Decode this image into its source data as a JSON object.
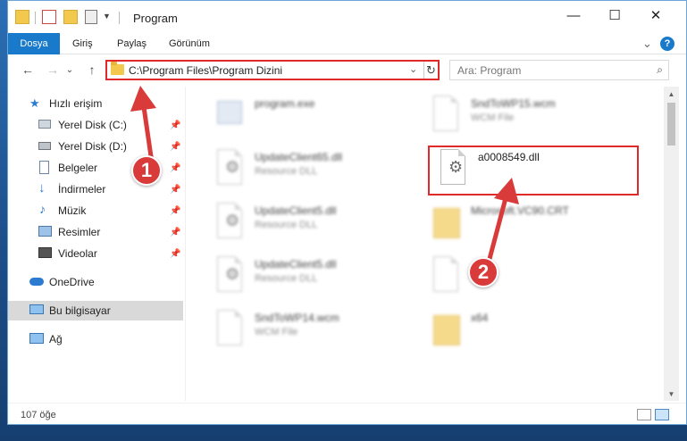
{
  "window": {
    "title": "Program",
    "controls": {
      "minimize": "—",
      "maximize": "☐",
      "close": "✕"
    }
  },
  "ribbon": {
    "tabs": [
      "Dosya",
      "Giriş",
      "Paylaş",
      "Görünüm"
    ],
    "expand_icon": "⌄",
    "help_icon": "?"
  },
  "address": {
    "back": "←",
    "forward": "→",
    "recent": "⌄",
    "up": "↑",
    "path": "C:\\Program Files\\Program Dizini",
    "dropdown": "⌄",
    "refresh": "↻"
  },
  "search": {
    "placeholder": "Ara: Program",
    "icon": "⌕"
  },
  "sidebar": {
    "items": [
      {
        "label": "Hızlı erişim",
        "icon": "star-icon"
      },
      {
        "label": "Yerel Disk (C:)",
        "icon": "drive-icon",
        "pinned": true
      },
      {
        "label": "Yerel Disk (D:)",
        "icon": "drive-icon",
        "pinned": true
      },
      {
        "label": "Belgeler",
        "icon": "documents-icon",
        "pinned": true
      },
      {
        "label": "İndirmeler",
        "icon": "download-icon",
        "pinned": true
      },
      {
        "label": "Müzik",
        "icon": "music-icon",
        "pinned": true
      },
      {
        "label": "Resimler",
        "icon": "pictures-icon",
        "pinned": true
      },
      {
        "label": "Videolar",
        "icon": "videos-icon",
        "pinned": true
      },
      {
        "label": "OneDrive",
        "icon": "cloud-icon"
      },
      {
        "label": "Bu bilgisayar",
        "icon": "computer-icon",
        "selected": true
      },
      {
        "label": "Ağ",
        "icon": "network-icon"
      }
    ],
    "pin_glyph": "📌"
  },
  "files": [
    {
      "name": "program.exe",
      "type": ""
    },
    {
      "name": "SndToWP15.wcm",
      "type": "WCM File"
    },
    {
      "name": "UpdateClient65.dll",
      "type": "Resource DLL"
    },
    {
      "name": "a0008549.dll",
      "type": ""
    },
    {
      "name": "UpdateClient5.dll",
      "type": "Resource DLL"
    },
    {
      "name": "Microsoft.VC90.CRT",
      "type": ""
    },
    {
      "name": "UpdateClient5.dll",
      "type": "Resource DLL"
    },
    {
      "name": "",
      "type": ""
    },
    {
      "name": "SndToWP14.wcm",
      "type": "WCM File"
    },
    {
      "name": "x64",
      "type": ""
    }
  ],
  "status": {
    "count": "107 öğe"
  },
  "annotations": {
    "step1": "1",
    "step2": "2"
  },
  "colors": {
    "accent": "#1979ca",
    "highlight": "#e02a2a",
    "badge": "#d93a3a"
  }
}
